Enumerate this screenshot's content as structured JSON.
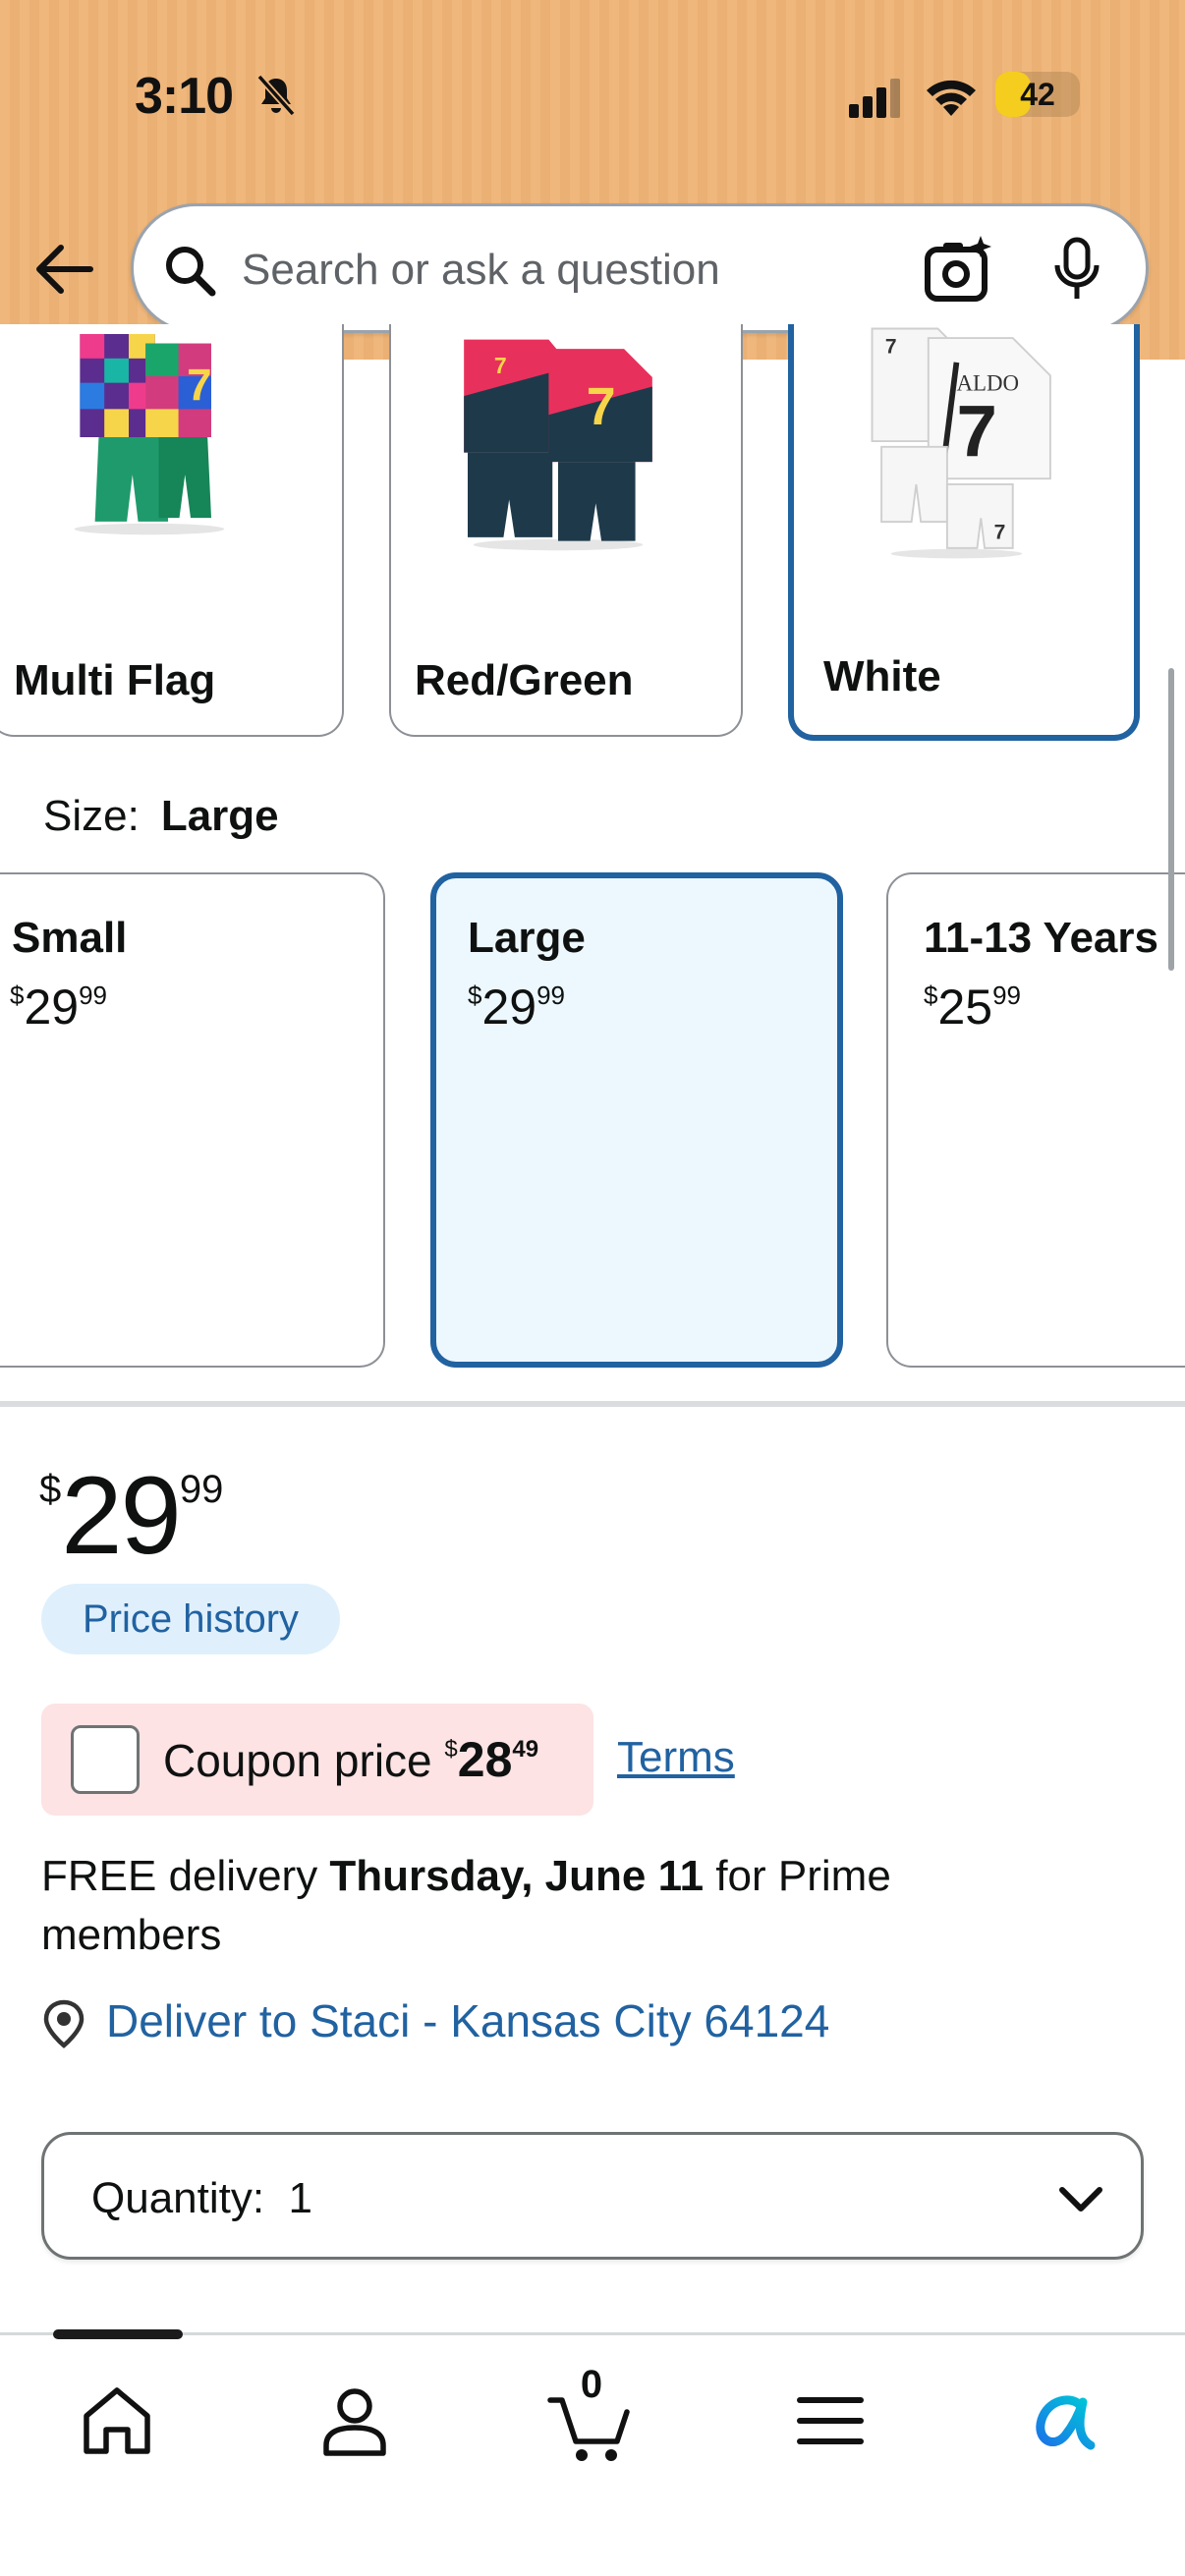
{
  "status_bar": {
    "time": "3:10",
    "battery": "42",
    "battery_level_percent": 42
  },
  "search": {
    "placeholder": "Search or ask a question"
  },
  "style_options": [
    {
      "label": "Multi Flag",
      "selected": false
    },
    {
      "label": "Red/Green",
      "selected": false
    },
    {
      "label": "White",
      "selected": true
    }
  ],
  "size": {
    "label": "Size:",
    "selected_value": "Large",
    "options": [
      {
        "name": "Small",
        "currency": "$",
        "whole": "29",
        "fraction": "99",
        "selected": false
      },
      {
        "name": "Large",
        "currency": "$",
        "whole": "29",
        "fraction": "99",
        "selected": true
      },
      {
        "name": "11-13 Years",
        "currency": "$",
        "whole": "25",
        "fraction": "99",
        "selected": false
      }
    ]
  },
  "price": {
    "currency": "$",
    "whole": "29",
    "fraction": "99",
    "history_label": "Price history"
  },
  "coupon": {
    "label": "Coupon price",
    "currency": "$",
    "whole": "28",
    "fraction": "49",
    "terms_label": "Terms",
    "checked": false
  },
  "delivery": {
    "prefix": "FREE delivery",
    "date": "Thursday, June 11",
    "suffix": "for Prime members",
    "location": "Deliver to Staci - Kansas City 64124"
  },
  "quantity": {
    "label": "Quantity:",
    "value": "1"
  },
  "bottom_nav": {
    "cart_count": "0",
    "items": [
      "home-icon",
      "account-icon",
      "cart-icon",
      "menu-icon",
      "rufus-ai-icon"
    ]
  },
  "colors": {
    "header_bg": "#efb77c",
    "link_blue": "#2162a1",
    "selected_border": "#2162a1",
    "selected_bg": "#edf8fe",
    "coupon_bg": "#fde3e4",
    "price_history_bg": "#dff0fc",
    "battery_yellow": "#f5cd1f"
  }
}
